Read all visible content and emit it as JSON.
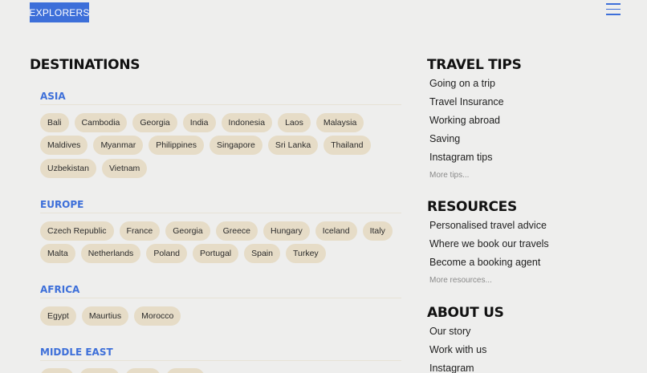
{
  "header": {
    "logo": "EXPLORERS",
    "menu_icon": "hamburger-menu-icon"
  },
  "destinations": {
    "title": "DESTINATIONS",
    "regions": [
      {
        "name": "ASIA",
        "rows": [
          [
            "Bali",
            "Cambodia",
            "Georgia",
            "India",
            "Indonesia",
            "Laos",
            "Malaysia"
          ],
          [
            "Maldives",
            "Myanmar",
            "Philippines",
            "Singapore",
            "Sri Lanka",
            "Thailand"
          ],
          [
            "Uzbekistan",
            "Vietnam"
          ]
        ]
      },
      {
        "name": "EUROPE",
        "rows": [
          [
            "Czech Republic",
            "France",
            "Georgia",
            "Greece",
            "Hungary",
            "Iceland",
            "Italy"
          ],
          [
            "Malta",
            "Netherlands",
            "Poland",
            "Portugal",
            "Spain",
            "Turkey"
          ]
        ]
      },
      {
        "name": "AFRICA",
        "rows": [
          [
            "Egypt",
            "Maurtius",
            "Morocco"
          ]
        ]
      },
      {
        "name": "MIDDLE EAST",
        "rows": []
      }
    ]
  },
  "travel_tips": {
    "title": "TRAVEL TIPS",
    "items": [
      "Going on a trip",
      "Travel Insurance",
      "Working abroad",
      "Saving",
      "Instagram tips"
    ],
    "more": "More tips..."
  },
  "resources": {
    "title": "RESOURCES",
    "items": [
      "Personalised travel advice",
      "Where we book our travels",
      "Become a booking agent"
    ],
    "more": "More resources..."
  },
  "about": {
    "title": "ABOUT US",
    "items": [
      "Our story",
      "Work with us",
      "Instagram"
    ]
  },
  "colors": {
    "accent": "#3d6fd9",
    "chip": "#e6dcc7",
    "background": "#eeeeed"
  }
}
